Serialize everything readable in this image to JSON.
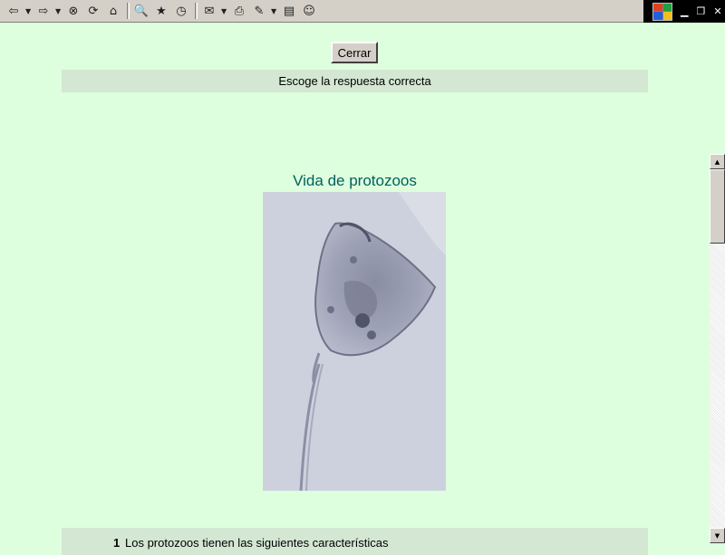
{
  "toolbar": {
    "icons": [
      {
        "name": "back-icon",
        "glyph": "⇦"
      },
      {
        "name": "forward-icon",
        "glyph": "⇨"
      },
      {
        "name": "stop-icon",
        "glyph": "⊗"
      },
      {
        "name": "refresh-icon",
        "glyph": "⟳"
      },
      {
        "name": "home-icon",
        "glyph": "⌂"
      },
      {
        "name": "search-icon",
        "glyph": "🔍"
      },
      {
        "name": "favorites-icon",
        "glyph": "★"
      },
      {
        "name": "history-icon",
        "glyph": "◷"
      },
      {
        "name": "mail-icon",
        "glyph": "✉"
      },
      {
        "name": "print-icon",
        "glyph": "⎙"
      },
      {
        "name": "edit-icon",
        "glyph": "✎"
      },
      {
        "name": "document-icon",
        "glyph": "▤"
      },
      {
        "name": "messenger-icon",
        "glyph": "☺"
      }
    ]
  },
  "page": {
    "close_button_label": "Cerrar",
    "instruction": "Escoge la respuesta correcta",
    "title": "Vida de protozoos",
    "question_number": "1",
    "question_text": "Los protozoos tienen las siguientes características"
  },
  "colors": {
    "page_background": "#ddffdd",
    "bar_background": "#d3e7d3",
    "title_color": "#006060"
  }
}
